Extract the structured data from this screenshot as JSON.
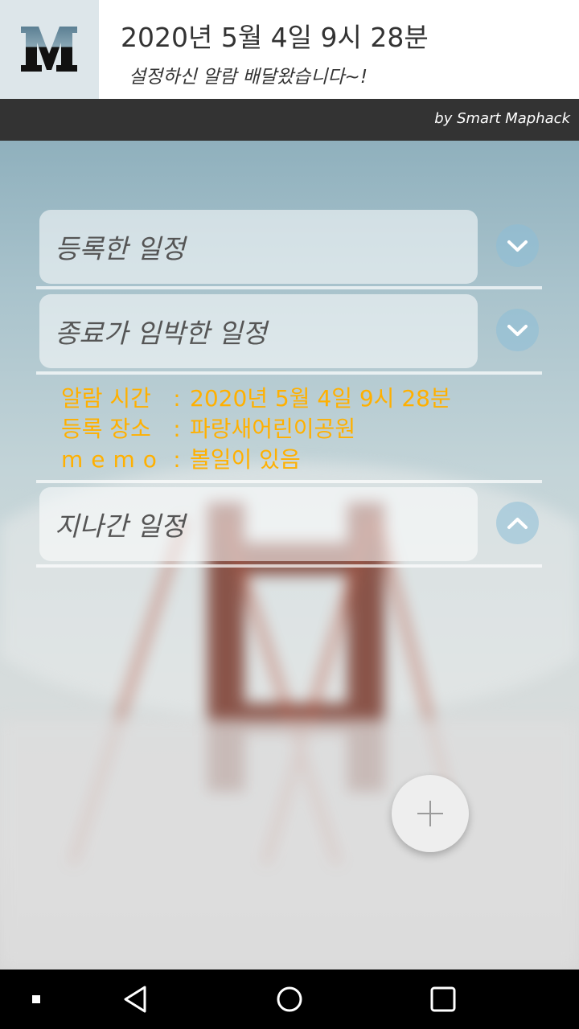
{
  "notification": {
    "logo_icon": "maphack-m-logo",
    "title": "2020년 5월 4일 9시 28분",
    "subtitle": "설정하신 알람 배달왔습니다~!"
  },
  "byline": "by Smart Maphack",
  "sections": [
    {
      "label": "등록한 일정",
      "state": "collapsed",
      "icon": "chevron-down-icon"
    },
    {
      "label": "종료가 임박한 일정",
      "state": "expanded",
      "icon": "chevron-down-icon"
    },
    {
      "label": "지나간 일정",
      "state": "collapsed",
      "icon": "chevron-up-icon"
    }
  ],
  "schedule_detail": {
    "time_label": "알람 시간",
    "time_value": "2020년 5월 4일 9시 28분",
    "place_label": "등록 장소",
    "place_value": "파랑새어린이공원",
    "memo_label": "memo",
    "memo_value": "볼일이 있음",
    "separator": ":"
  },
  "fab": {
    "icon": "plus-icon"
  },
  "navbar": {
    "items": [
      "recent-apps-dot-icon",
      "back-icon",
      "home-icon",
      "overview-icon"
    ]
  },
  "colors": {
    "detail_text": "#ffb000",
    "header_bar": "#333333",
    "toggle_bg": "#8cbed7"
  }
}
